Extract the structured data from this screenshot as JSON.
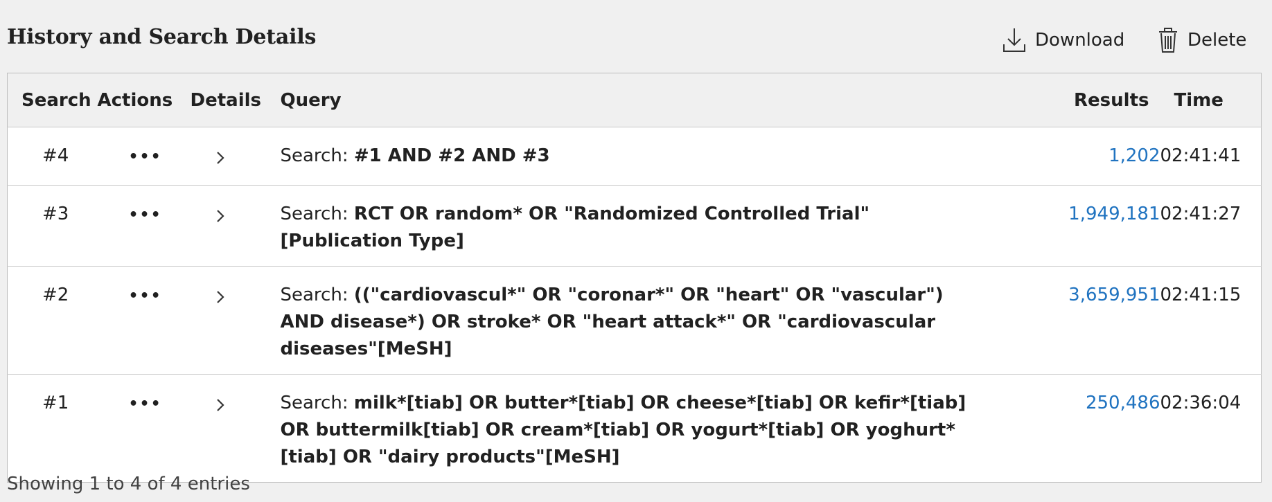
{
  "header": {
    "title": "History and Search Details",
    "download_label": "Download",
    "delete_label": "Delete"
  },
  "table": {
    "columns": [
      "Search",
      "Actions",
      "Details",
      "Query",
      "Results",
      "Time"
    ],
    "query_prefix": "Search: ",
    "actions_icon": "more-options-icon",
    "details_icon": "chevron-right-icon",
    "rows": [
      {
        "search": "#4",
        "query": "#1 AND #2 AND #3",
        "results": "1,202",
        "time": "02:41:41"
      },
      {
        "search": "#3",
        "query": "RCT OR random* OR \"Randomized Controlled Trial\"[Publication Type]",
        "results": "1,949,181",
        "time": "02:41:27"
      },
      {
        "search": "#2",
        "query": "((\"cardiovascul*\" OR \"coronar*\" OR \"heart\" OR \"vascular\") AND disease*) OR stroke* OR \"heart attack*\" OR \"cardiovascular diseases\"[MeSH]",
        "results": "3,659,951",
        "time": "02:41:15"
      },
      {
        "search": "#1",
        "query": "milk*[tiab] OR butter*[tiab] OR cheese*[tiab] OR kefir*[tiab] OR buttermilk[tiab] OR cream*[tiab] OR yogurt*[tiab] OR yoghurt*[tiab] OR \"dairy products\"[MeSH]",
        "results": "250,486",
        "time": "02:36:04"
      }
    ]
  },
  "footer": {
    "entries_text": "Showing 1 to 4 of 4 entries"
  },
  "colors": {
    "background": "#f0f0f0",
    "table_bg": "#ffffff",
    "link": "#2073c0",
    "text": "#212121"
  }
}
